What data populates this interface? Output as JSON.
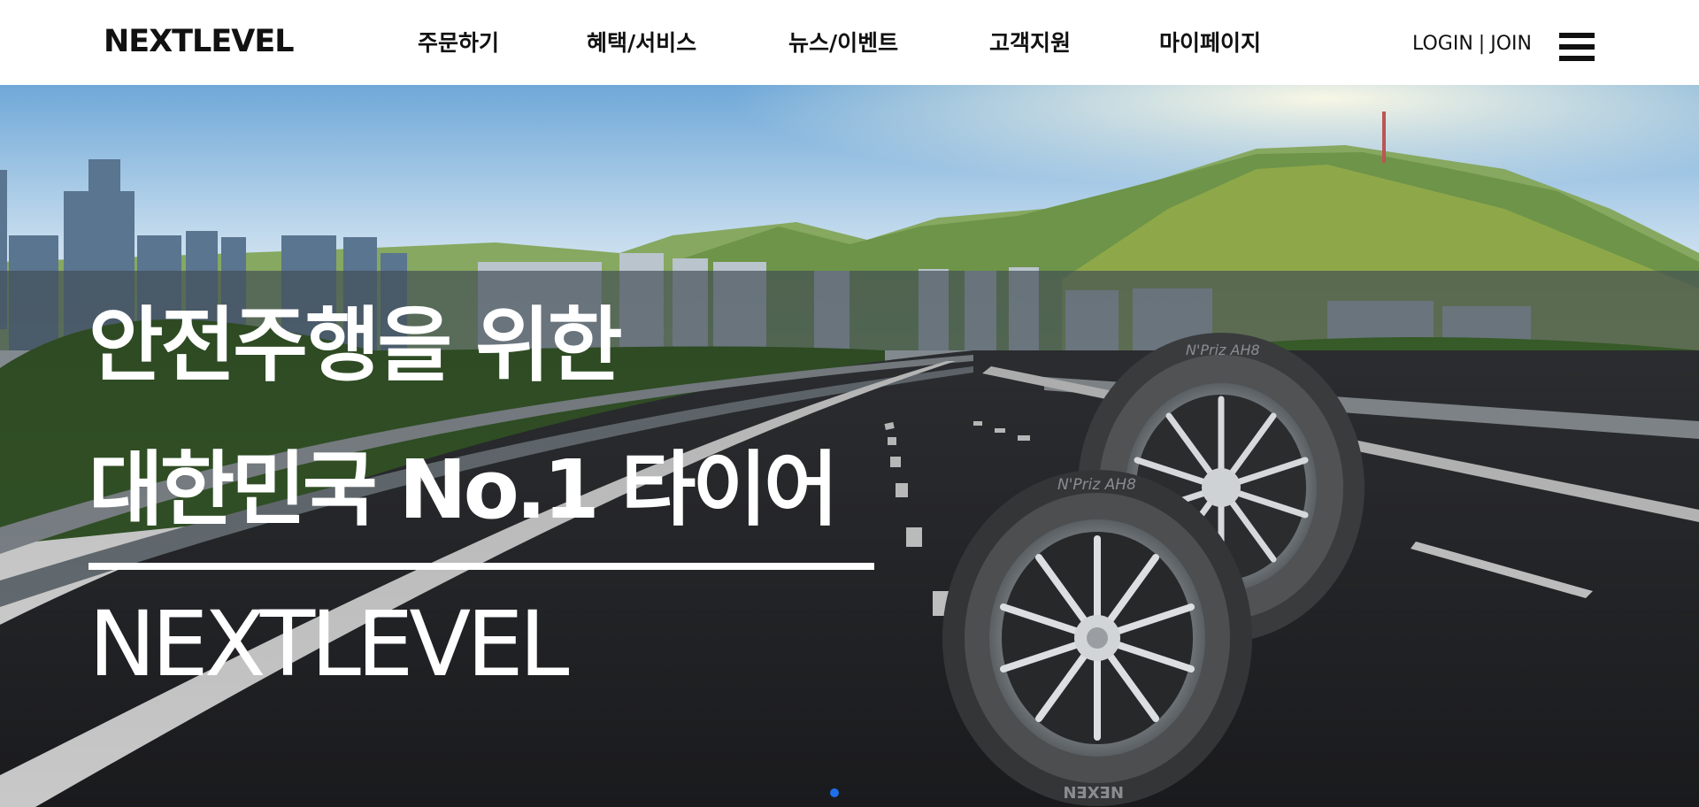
{
  "header": {
    "logo": "NEXTLEVEL",
    "nav": [
      "주문하기",
      "혜택/서비스",
      "뉴스/이벤트",
      "고객지원",
      "마이페이지"
    ],
    "login": "LOGIN",
    "separator": "|",
    "join": "JOIN",
    "menu_icon": "hamburger-menu-icon"
  },
  "hero": {
    "line1": "안전주행을 위한",
    "line2": "대한민국 No.1 타이어",
    "line3": "NEXTLEVEL",
    "tire_brand": "NEXEN",
    "tire_model": "N'Priz AH8",
    "active_slide": 1,
    "slide_count": 1
  },
  "colors": {
    "header_bg": "#ffffff",
    "text_dark": "#111111",
    "hero_text": "#ffffff",
    "pager_active": "#1e6fe8",
    "sky_top": "#6fa8d8",
    "asphalt": "#2b2d31"
  }
}
